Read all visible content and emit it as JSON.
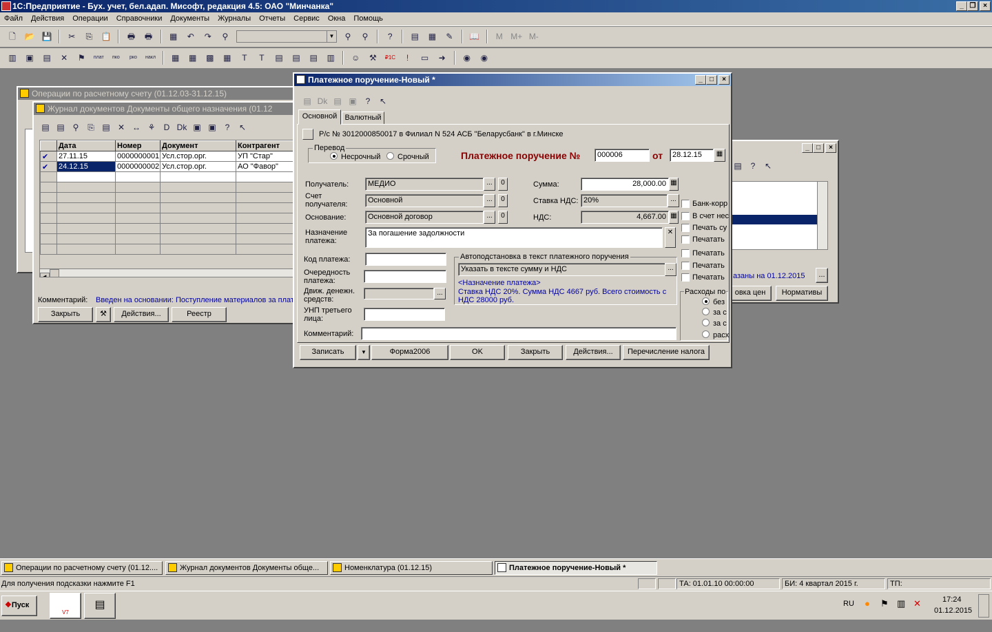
{
  "app": {
    "title": "1С:Предприятие - Бух. учет, бел.адап. Мисофт, редакция 4.5: ОАО \"Минчанка\""
  },
  "menu": [
    "Файл",
    "Действия",
    "Операции",
    "Справочники",
    "Документы",
    "Журналы",
    "Отчеты",
    "Сервис",
    "Окна",
    "Помощь"
  ],
  "toolbar1_extra": [
    "M",
    "M+",
    "M-"
  ],
  "win_ops": {
    "title": "Операции по расчетному счету (01.12.03-31.12.15)"
  },
  "win_journal": {
    "title": "Журнал документов  Документы общего назначения (01.12",
    "columns": [
      "Дата",
      "Номер",
      "Документ",
      "Контрагент"
    ],
    "rows": [
      {
        "date": "27.11.15",
        "num": "0000000001",
        "doc": "Усл.стор.орг.",
        "kontr": "УП \"Стар\""
      },
      {
        "date": "24.12.15",
        "num": "0000000002",
        "doc": "Усл.стор.орг.",
        "kontr": "АО \"Фавор\""
      }
    ],
    "comment_label": "Комментарий:",
    "comment_value": "Введен на основании: Поступление материалов за плат",
    "buttons": {
      "close": "Закрыть",
      "actions": "Действия...",
      "registry": "Реестр"
    }
  },
  "win_back": {
    "text1": "азаны на 01.12.2015",
    "btn_price": "овка цен",
    "btn_norm": "Нормативы",
    "btn_more": "..."
  },
  "dialog": {
    "title": "Платежное поручение-Новый *",
    "tabs": [
      "Основной",
      "Валютный"
    ],
    "account_line": "Р/с № 3012000850017 в Филиал N 524 АСБ \"Беларусбанк\" в г.Минске",
    "transfer_group": "Перевод",
    "transfer_opt1": "Несрочный",
    "transfer_opt2": "Срочный",
    "heading": "Платежное поручение №",
    "number": "000006",
    "from_label": "от",
    "date": "28.12.15",
    "recipient_label": "Получатель:",
    "recipient": "МЕДИО",
    "account_label": "Счет получателя:",
    "account": "Основной",
    "basis_label": "Основание:",
    "basis": "Основной договор",
    "purpose_label": "Назначение платежа:",
    "purpose": "За погашение задолжности",
    "sum_label": "Сумма:",
    "sum": "28,000.00",
    "vat_rate_label": "Ставка НДС:",
    "vat_rate": "20%",
    "vat_label": "НДС:",
    "vat": "4,667.00",
    "zero": "0",
    "checkboxes": [
      "Банк-корр",
      "В счет нес",
      "Печать су",
      "Печатать",
      "Печатать",
      "Печатать",
      "Печатать"
    ],
    "expenses_group": "Расходы по",
    "expenses_opts": [
      "без",
      "за с",
      "за с",
      "расх"
    ],
    "paycode_label": "Код платежа:",
    "order_label": "Очередность платежа:",
    "cashflow_label": "Движ. денежн. средств:",
    "unp_label": "УНП третьего лица:",
    "auto_group": "Автоподстановка в текст платежного поручения",
    "auto_value": "Указать в тексте сумму и НДС",
    "auto_preview_1": "<Назначение платежа>",
    "auto_preview_2": "Ставка НДС 20%. Сумма НДС 4667 руб. Всего стоимость с НДС 28000 руб.",
    "comment_label": "Комментарий:",
    "buttons": {
      "save": "Записать",
      "form": "Форма2006",
      "ok": "OK",
      "close": "Закрыть",
      "actions": "Действия...",
      "tax": "Перечисление налога"
    }
  },
  "tasks": [
    "Операции по расчетному счету (01.12....",
    "Журнал документов  Документы обще...",
    "Номенклатура  (01.12.15)",
    "Платежное поручение-Новый *"
  ],
  "status": {
    "hint": "Для получения подсказки нажмите F1",
    "ta": "ТА: 01.01.10  00:00:00",
    "bi": "БИ: 4 квартал 2015 г.",
    "tp": "ТП:"
  },
  "windows_taskbar": {
    "start": "Пуск",
    "lang": "RU",
    "time": "17:24",
    "date": "01.12.2015",
    "app_label": "V7"
  }
}
